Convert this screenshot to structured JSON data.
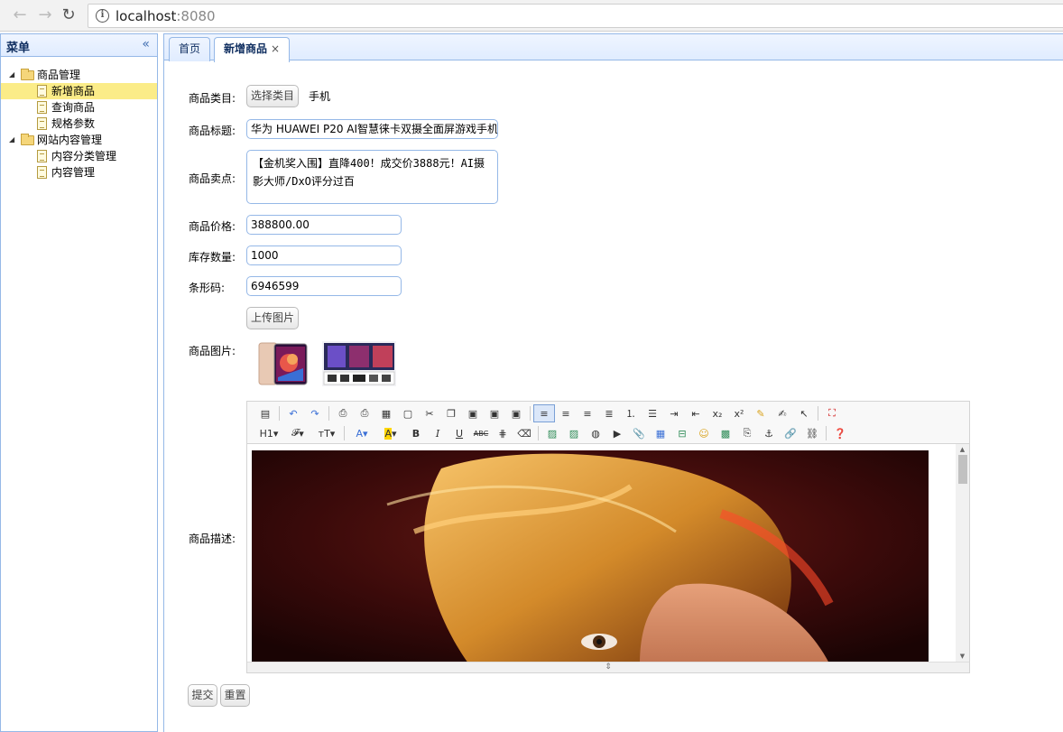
{
  "browser": {
    "url_host": "localhost",
    "url_port": ":8080"
  },
  "menu": {
    "title": "菜单",
    "groups": [
      {
        "label": "商品管理",
        "items": [
          "新增商品",
          "查询商品",
          "规格参数"
        ]
      },
      {
        "label": "网站内容管理",
        "items": [
          "内容分类管理",
          "内容管理"
        ]
      }
    ],
    "selected": "新增商品"
  },
  "tabs": [
    {
      "label": "首页"
    },
    {
      "label": "新增商品",
      "close": "×"
    }
  ],
  "form": {
    "category_label": "商品类目:",
    "category_button": "选择类目",
    "category_value": "手机",
    "title_label": "商品标题:",
    "title_value": "华为 HUAWEI P20 AI智慧徕卡双摄全面屏游戏手机",
    "sellpoint_label": "商品卖点:",
    "sellpoint_value": "【金机奖入围】直降400！成交价3888元！AI摄影大师/DxO评分过百",
    "price_label": "商品价格:",
    "price_value": "388800.00",
    "stock_label": "库存数量:",
    "stock_value": "1000",
    "barcode_label": "条形码:",
    "barcode_value": "6946599",
    "upload_button": "上传图片",
    "image_label": "商品图片:",
    "desc_label": "商品描述:",
    "submit_button": "提交",
    "reset_button": "重置"
  },
  "editor": {
    "row1": [
      "source",
      "undo",
      "redo",
      "preview",
      "print",
      "template",
      "code",
      "cut",
      "copy",
      "paste",
      "paste-text",
      "paste-word",
      "align-left",
      "align-center",
      "align-right",
      "align-justify",
      "ordered-list",
      "unordered-list",
      "indent",
      "outdent",
      "subscript",
      "superscript",
      "clear-format",
      "select-all",
      "pointer",
      "fullscreen"
    ],
    "row2": [
      "heading",
      "font-family",
      "font-size",
      "font-color",
      "highlight-color",
      "bold",
      "italic",
      "underline",
      "strikethrough",
      "line-height",
      "remove-format",
      "image",
      "multi-image",
      "flash",
      "media",
      "attachment",
      "table",
      "hr",
      "emoticon",
      "baidu-map",
      "page-break",
      "anchor",
      "link",
      "unlink",
      "help"
    ],
    "row2_text": {
      "heading": "H1",
      "font_family": "𝓕",
      "font_size": "тT",
      "font_color": "A",
      "highlight": "A",
      "bold": "B",
      "italic": "I",
      "underline": "U",
      "strike": "ABC"
    },
    "row1_text": {
      "subscript": "x₂",
      "superscript": "x²"
    }
  },
  "colors": {
    "panel_border": "#95b8e7",
    "selected": "#fbec88",
    "header_bg": "#e0ecff"
  }
}
